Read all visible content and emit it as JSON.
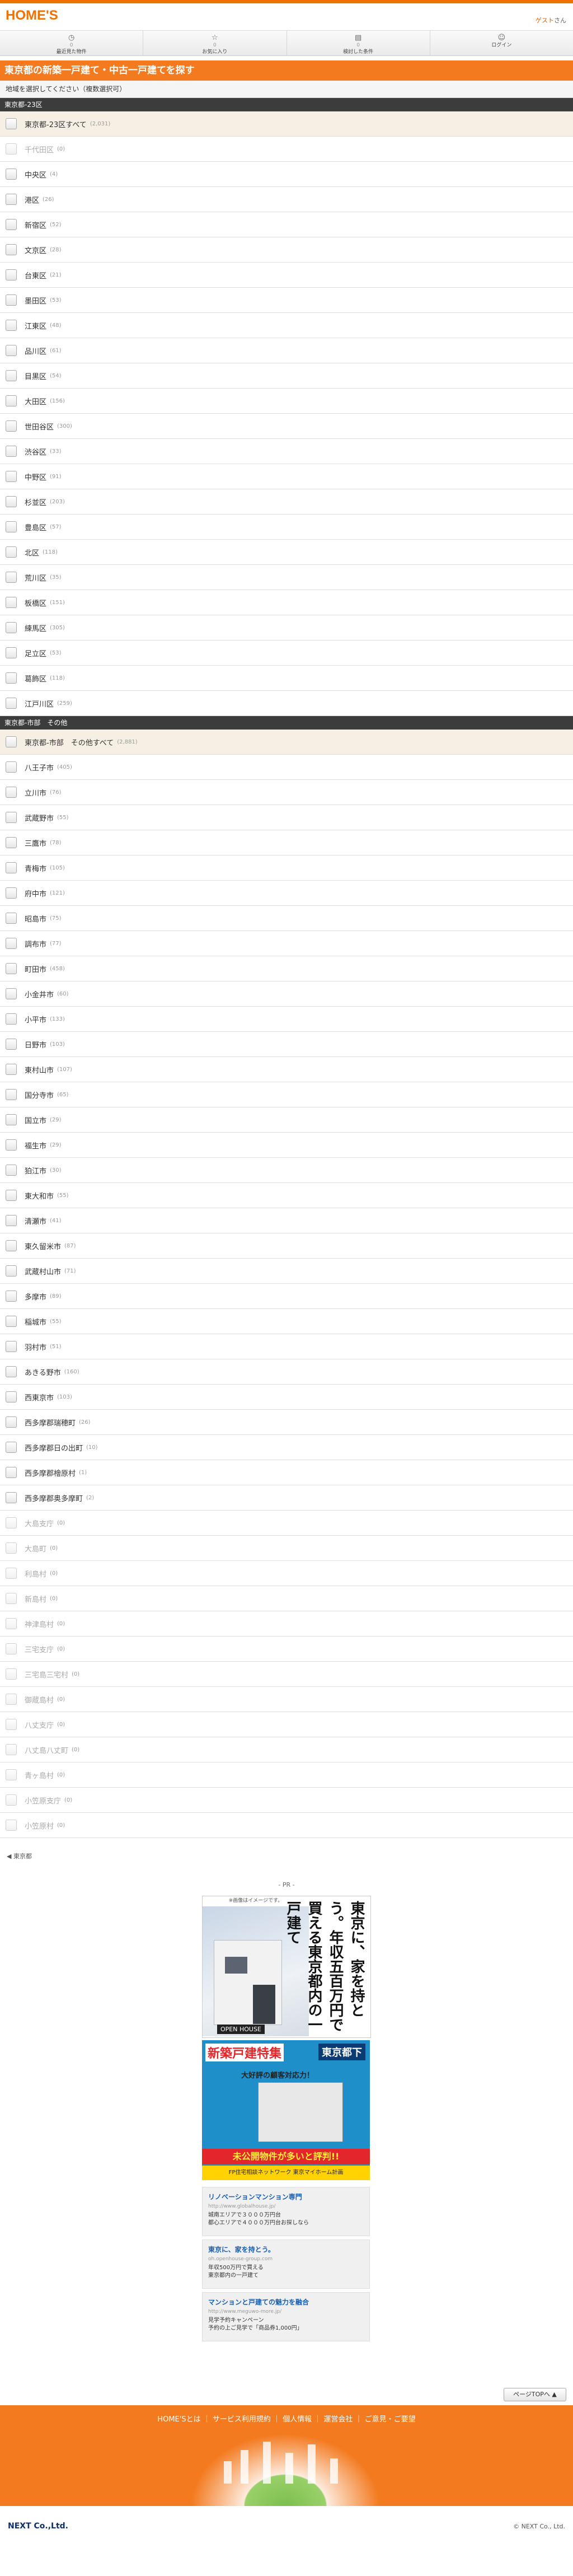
{
  "header": {
    "logo": "HOME'S",
    "user_name": "ゲスト",
    "user_suffix": "さん"
  },
  "nav": [
    {
      "icon": "clock-icon",
      "glyph": "◷",
      "count": "0",
      "label": "最近見た物件"
    },
    {
      "icon": "star-icon",
      "glyph": "☆",
      "count": "0",
      "label": "お気に入り"
    },
    {
      "icon": "clipboard-icon",
      "glyph": "▤",
      "count": "0",
      "label": "検討した条件"
    },
    {
      "icon": "person-icon",
      "glyph": "☺",
      "count": "",
      "label": "ログイン"
    }
  ],
  "title": "東京都の新築一戸建て・中古一戸建てを探す",
  "instruction": "地域を選択してください（複数選択可）",
  "sections": [
    {
      "label": "東京都-23区",
      "rows": [
        {
          "name": "東京都-23区すべて",
          "count": "(2,031)",
          "all": true
        },
        {
          "name": "千代田区",
          "count": "(0)",
          "disabled": true
        },
        {
          "name": "中央区",
          "count": "(4)"
        },
        {
          "name": "港区",
          "count": "(26)"
        },
        {
          "name": "新宿区",
          "count": "(52)"
        },
        {
          "name": "文京区",
          "count": "(28)"
        },
        {
          "name": "台東区",
          "count": "(21)"
        },
        {
          "name": "墨田区",
          "count": "(53)"
        },
        {
          "name": "江東区",
          "count": "(48)"
        },
        {
          "name": "品川区",
          "count": "(61)"
        },
        {
          "name": "目黒区",
          "count": "(54)"
        },
        {
          "name": "大田区",
          "count": "(156)"
        },
        {
          "name": "世田谷区",
          "count": "(300)"
        },
        {
          "name": "渋谷区",
          "count": "(33)"
        },
        {
          "name": "中野区",
          "count": "(91)"
        },
        {
          "name": "杉並区",
          "count": "(203)"
        },
        {
          "name": "豊島区",
          "count": "(57)"
        },
        {
          "name": "北区",
          "count": "(118)"
        },
        {
          "name": "荒川区",
          "count": "(35)"
        },
        {
          "name": "板橋区",
          "count": "(151)"
        },
        {
          "name": "練馬区",
          "count": "(305)"
        },
        {
          "name": "足立区",
          "count": "(53)"
        },
        {
          "name": "葛飾区",
          "count": "(118)"
        },
        {
          "name": "江戸川区",
          "count": "(259)"
        }
      ]
    },
    {
      "label": "東京都-市部　その他",
      "rows": [
        {
          "name": "東京都-市部　その他すべて",
          "count": "(2,881)",
          "all": true
        },
        {
          "name": "八王子市",
          "count": "(405)"
        },
        {
          "name": "立川市",
          "count": "(76)"
        },
        {
          "name": "武蔵野市",
          "count": "(55)"
        },
        {
          "name": "三鷹市",
          "count": "(78)"
        },
        {
          "name": "青梅市",
          "count": "(105)"
        },
        {
          "name": "府中市",
          "count": "(121)"
        },
        {
          "name": "昭島市",
          "count": "(75)"
        },
        {
          "name": "調布市",
          "count": "(77)"
        },
        {
          "name": "町田市",
          "count": "(458)"
        },
        {
          "name": "小金井市",
          "count": "(60)"
        },
        {
          "name": "小平市",
          "count": "(133)"
        },
        {
          "name": "日野市",
          "count": "(103)"
        },
        {
          "name": "東村山市",
          "count": "(107)"
        },
        {
          "name": "国分寺市",
          "count": "(65)"
        },
        {
          "name": "国立市",
          "count": "(29)"
        },
        {
          "name": "福生市",
          "count": "(29)"
        },
        {
          "name": "狛江市",
          "count": "(30)"
        },
        {
          "name": "東大和市",
          "count": "(55)"
        },
        {
          "name": "清瀬市",
          "count": "(41)"
        },
        {
          "name": "東久留米市",
          "count": "(87)"
        },
        {
          "name": "武蔵村山市",
          "count": "(71)"
        },
        {
          "name": "多摩市",
          "count": "(89)"
        },
        {
          "name": "稲城市",
          "count": "(55)"
        },
        {
          "name": "羽村市",
          "count": "(51)"
        },
        {
          "name": "あきる野市",
          "count": "(160)"
        },
        {
          "name": "西東京市",
          "count": "(103)"
        },
        {
          "name": "西多摩郡瑞穂町",
          "count": "(26)"
        },
        {
          "name": "西多摩郡日の出町",
          "count": "(10)"
        },
        {
          "name": "西多摩郡檜原村",
          "count": "(1)"
        },
        {
          "name": "西多摩郡奥多摩町",
          "count": "(2)"
        },
        {
          "name": "大島支庁",
          "count": "(0)",
          "disabled": true
        },
        {
          "name": "大島町",
          "count": "(0)",
          "disabled": true
        },
        {
          "name": "利島村",
          "count": "(0)",
          "disabled": true
        },
        {
          "name": "新島村",
          "count": "(0)",
          "disabled": true
        },
        {
          "name": "神津島村",
          "count": "(0)",
          "disabled": true
        },
        {
          "name": "三宅支庁",
          "count": "(0)",
          "disabled": true
        },
        {
          "name": "三宅島三宅村",
          "count": "(0)",
          "disabled": true
        },
        {
          "name": "御蔵島村",
          "count": "(0)",
          "disabled": true
        },
        {
          "name": "八丈支庁",
          "count": "(0)",
          "disabled": true
        },
        {
          "name": "八丈島八丈町",
          "count": "(0)",
          "disabled": true
        },
        {
          "name": "青ヶ島村",
          "count": "(0)",
          "disabled": true
        },
        {
          "name": "小笠原支庁",
          "count": "(0)",
          "disabled": true
        },
        {
          "name": "小笠原村",
          "count": "(0)",
          "disabled": true
        }
      ]
    }
  ],
  "note": "◀ 東京都",
  "ads": {
    "pr": "- PR -",
    "ad1_caption": "※画像はイメージです。",
    "ad1_logo": "OPEN HOUSE",
    "ad1_text": "東京に、家を持とう。年収五百万円で買える東京都内の一戸建て",
    "ad2_t1": "新築戸建特集",
    "ad2_t2": "東京都下",
    "ad2_t3": "大好評の顧客対応力！",
    "ad2_t4": "未公開物件が多いと評判!!",
    "ad2_t5": "FP住宅相談ネットワーク 東京マイホーム計画",
    "text_ads": [
      {
        "h": "リノベーションマンション専門",
        "u": "http://www.globalhouse.jp/",
        "d": "城南エリアで３０００万円台\n都心エリアで４０００万円台お探しなら"
      },
      {
        "h": "東京に、家を持とう。",
        "u": "oh.openhouse-group.com",
        "d": "年収500万円で買える\n東京都内の一戸建て"
      },
      {
        "h": "マンションと戸建ての魅力を融合",
        "u": "http://www.meguwo-more.jp/",
        "d": "見学予約キャンペーン\n予約の上ご見学で「商品券1,000円」"
      }
    ]
  },
  "page_top": "ページTOPへ ▲",
  "footer": {
    "links": "HOME'Sとは ｜ サービス利用規約 ｜ 個人情報 ｜ 運営会社 ｜ ご意見・ご要望",
    "company": "NEXT Co.,Ltd.",
    "copyright": "© NEXT Co., Ltd."
  },
  "colors": {
    "accent": "#f37a1f",
    "brand": "#f07000",
    "dark": "#3c3c3c"
  }
}
